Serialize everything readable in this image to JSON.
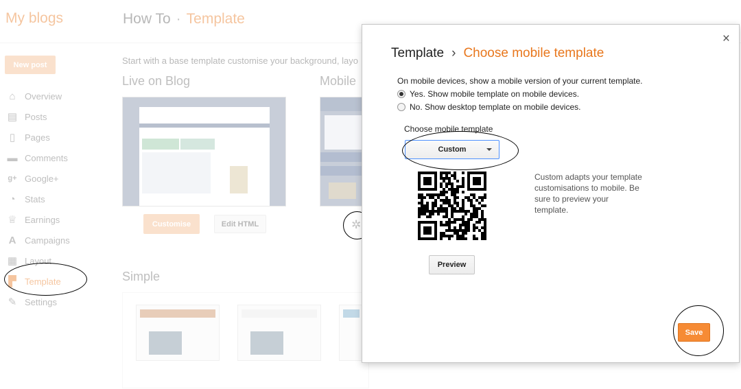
{
  "app": {
    "brand": "My blogs"
  },
  "breadcrumb": {
    "blog": "How To",
    "separator": "·",
    "current": "Template"
  },
  "sidebar": {
    "new_post": "New post",
    "items": [
      {
        "label": "Overview",
        "icon": "home-icon",
        "glyph": "⌂"
      },
      {
        "label": "Posts",
        "icon": "document-icon",
        "glyph": "▤"
      },
      {
        "label": "Pages",
        "icon": "page-icon",
        "glyph": "▯"
      },
      {
        "label": "Comments",
        "icon": "comment-icon",
        "glyph": "▬"
      },
      {
        "label": "Google+",
        "icon": "google-plus-icon",
        "glyph": "g+"
      },
      {
        "label": "Stats",
        "icon": "pie-chart-icon",
        "glyph": "◔"
      },
      {
        "label": "Earnings",
        "icon": "trophy-icon",
        "glyph": "♕"
      },
      {
        "label": "Campaigns",
        "icon": "campaign-icon",
        "glyph": "A"
      },
      {
        "label": "Layout",
        "icon": "layout-icon",
        "glyph": "▦"
      },
      {
        "label": "Template",
        "icon": "paint-roller-icon",
        "glyph": "▛"
      },
      {
        "label": "Settings",
        "icon": "wrench-icon",
        "glyph": "✎"
      }
    ],
    "active": "Template"
  },
  "main": {
    "intro": "Start with a base template customise your background, layo",
    "live_heading": "Live on Blog",
    "mobile_heading": "Mobile",
    "customise_label": "Customise",
    "edit_html_label": "Edit HTML",
    "simple_heading": "Simple"
  },
  "modal": {
    "title_root": "Template",
    "title_sep": "›",
    "title_current": "Choose mobile template",
    "close": "×",
    "question": "On mobile devices, show a mobile version of your current template.",
    "option_yes": "Yes. Show mobile template on mobile devices.",
    "option_no": "No. Show desktop template on mobile devices.",
    "selected_option": "yes",
    "choose_label": "Choose mobile template",
    "selected_template": "Custom",
    "description": "Custom adapts your template customisations to mobile. Be sure to preview your template.",
    "preview_label": "Preview",
    "save_label": "Save"
  },
  "colors": {
    "accent": "#e8771d",
    "save": "#f68b35",
    "focus": "#4d90fe"
  }
}
